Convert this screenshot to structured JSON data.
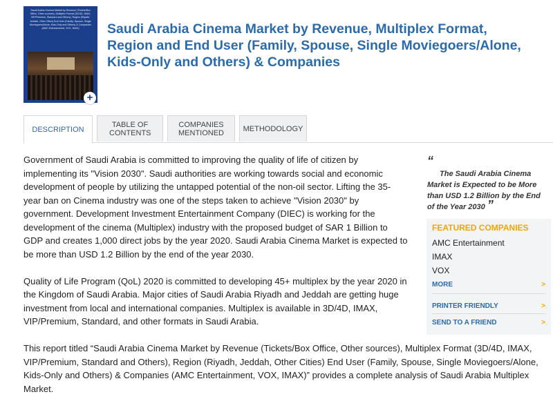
{
  "cover": {
    "text": "Saudi Arabia Cinema Market by Revenue (Tickets/Box Office, Other sources), Multiplex Format (3D/4D, IMAX, VIP/Premium, Standard and Others), Region (Riyadh, Jeddah, Other Cities) End User (Family, Spouse, Single Moviegoers/Alone, Kids-Only and Others) & Companies (AMC Entertainment, VOX, IMAX)",
    "zoom_icon": "plus-icon"
  },
  "title": "Saudi Arabia Cinema Market by Revenue, Multiplex Format, Region and End User (Family, Spouse, Single Moviegoers/Alone, Kids-Only and Others) & Companies",
  "tabs": [
    {
      "label": "DESCRIPTION",
      "active": true
    },
    {
      "label": "TABLE OF CONTENTS",
      "active": false
    },
    {
      "label": "COMPANIES MENTIONED",
      "active": false
    },
    {
      "label": "METHODOLOGY",
      "active": false
    }
  ],
  "description": {
    "p1": "Government of Saudi Arabia is committed to improving the quality of life of citizen by implementing its \"Vision 2030\". Saudi authorities are working towards social and economic development of people by utilizing the untapped potential of the non-oil sector. Lifting the 35-year ban on Cinema industry was one of the steps taken to achieve \"Vision 2030\" by government. Development Investment Entertainment Company (DIEC) is working for the development of the cinema (Multiplex) industry with the proposed budget of SAR 1 Billion to GDP and creates 1,000 direct jobs by the year 2020. Saudi Arabia Cinema Market is expected to be more than USD 1.2 Billion by the end of the year 2030.",
    "p2": "Quality of Life Program (QoL) 2020 is committed to developing 45+ multiplex by the year 2020 in the Kingdom of Saudi Arabia. Major cities of Saudi Arabia Riyadh and Jeddah are getting huge investment from local and international companies. Multiplex is available in 3D/4D, IMAX, VIP/Premium, Standard, and other formats in Saudi Arabia.",
    "p3": "This report titled “Saudi Arabia Cinema Market by Revenue (Tickets/Box Office, Other sources), Multiplex Format (3D/4D, IMAX, VIP/Premium, Standard and Others), Region (Riyadh, Jeddah, Other Cities) End User (Family, Spouse, Single Moviegoers/Alone, Kids-Only and Others) & Companies (AMC Entertainment, VOX, IMAX)” provides a complete analysis of Saudi Arabia Multiplex Market."
  },
  "quote": {
    "open": "“",
    "text": "The Saudi Arabia Cinema Market is Expected to be More than USD 1.2 Billion by the End of the Year 2030",
    "close": "”"
  },
  "featured": {
    "heading": "FEATURED COMPANIES",
    "companies": [
      "AMC Entertainment",
      "IMAX",
      "VOX"
    ],
    "more_label": "MORE",
    "printer_label": "PRINTER FRIENDLY",
    "send_label": "SEND TO A FRIEND",
    "chevron": ">"
  },
  "colors": {
    "title": "#2c6aa8",
    "accent": "#f0a500",
    "cover_bg": "#1b3f8a"
  }
}
